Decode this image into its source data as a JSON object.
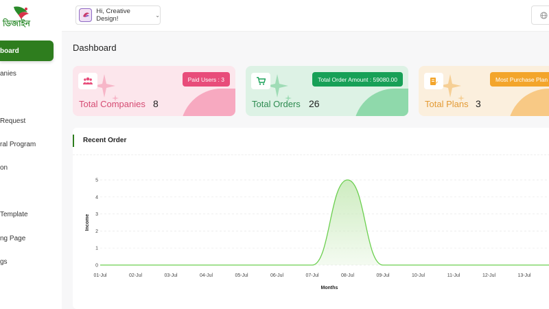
{
  "sidebar": {
    "logo_text": "ডিজাইন",
    "items": [
      {
        "label": "board",
        "active": true
      },
      {
        "label": "anies"
      },
      {
        "label": "Request"
      },
      {
        "label": "ral Program"
      },
      {
        "label": "on"
      },
      {
        "label": " Template"
      },
      {
        "label": "ng Page"
      },
      {
        "label": "gs"
      }
    ]
  },
  "header": {
    "user_greeting": "Hi, Creative Design!",
    "globe_icon": "globe-icon"
  },
  "page": {
    "title": "Dashboard"
  },
  "cards": [
    {
      "label": "Total Companies",
      "value": "8",
      "badge": "Paid Users : 3",
      "icon": "users-icon"
    },
    {
      "label": "Total Orders",
      "value": "26",
      "badge": "Total Order Amount : 59080.00",
      "icon": "cart-icon"
    },
    {
      "label": "Total Plans",
      "value": "3",
      "badge": "Most Purchase Plan",
      "icon": "document-icon"
    }
  ],
  "panel": {
    "title": "Recent Order"
  },
  "chart_data": {
    "type": "area",
    "x": [
      "01-Jul",
      "02-Jul",
      "03-Jul",
      "04-Jul",
      "05-Jul",
      "06-Jul",
      "07-Jul",
      "08-Jul",
      "09-Jul",
      "10-Jul",
      "11-Jul",
      "12-Jul",
      "13-Jul"
    ],
    "series": [
      {
        "values": [
          0,
          0,
          0,
          0,
          0,
          0,
          0,
          5,
          0,
          0,
          0,
          0,
          0
        ]
      }
    ],
    "xlabel": "Months",
    "ylabel": "Income",
    "ylim": [
      0,
      5
    ],
    "yticks": [
      0,
      1,
      2,
      3,
      4,
      5
    ],
    "grid": true,
    "colors": {
      "line": "#6bcf4f",
      "fill": "#c8eab9"
    }
  }
}
